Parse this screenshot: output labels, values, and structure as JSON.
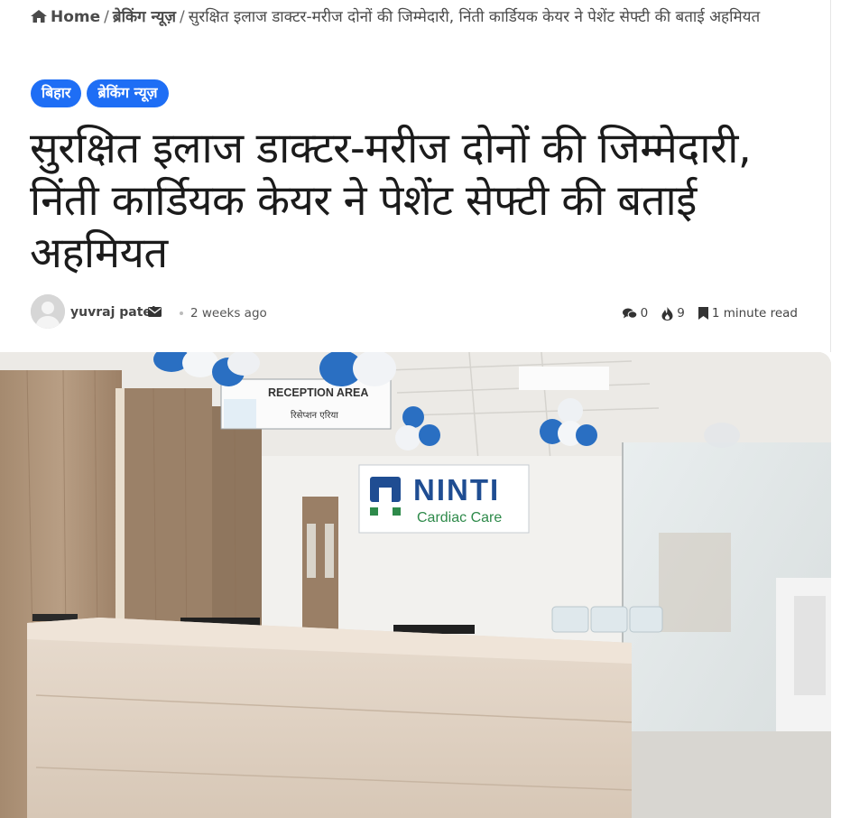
{
  "breadcrumb": {
    "home_label": "Home",
    "category_label": "ब्रेकिंग न्यूज़",
    "separator": "/",
    "current": "सुरक्षित इलाज डाक्टर-मरीज दोनों की जिम्मेदारी, निंती कार्डियक केयर ने पेशेंट सेफ्टी की बताई अहमियत"
  },
  "tags": [
    "बिहार",
    "ब्रेकिंग न्यूज़"
  ],
  "article": {
    "title": "सुरक्षित इलाज डाक्टर-मरीज दोनों की जिम्मेदारी, निंती कार्डियक केयर ने पेशेंट सेफ्टी की बताई अहमियत"
  },
  "meta": {
    "author": "yuvraj patel",
    "time": "2 weeks ago",
    "comments": "0",
    "views": "9",
    "read_time": "1 minute read"
  },
  "featured_image": {
    "sign_reception_en": "RECEPTION AREA",
    "sign_reception_hi": "रिसेप्शन एरिया",
    "logo_brand": "NINTI",
    "logo_tagline": "Cardiac Care"
  },
  "colors": {
    "accent": "#1e6ef5",
    "text": "#1b1b1b",
    "muted": "#555555"
  }
}
